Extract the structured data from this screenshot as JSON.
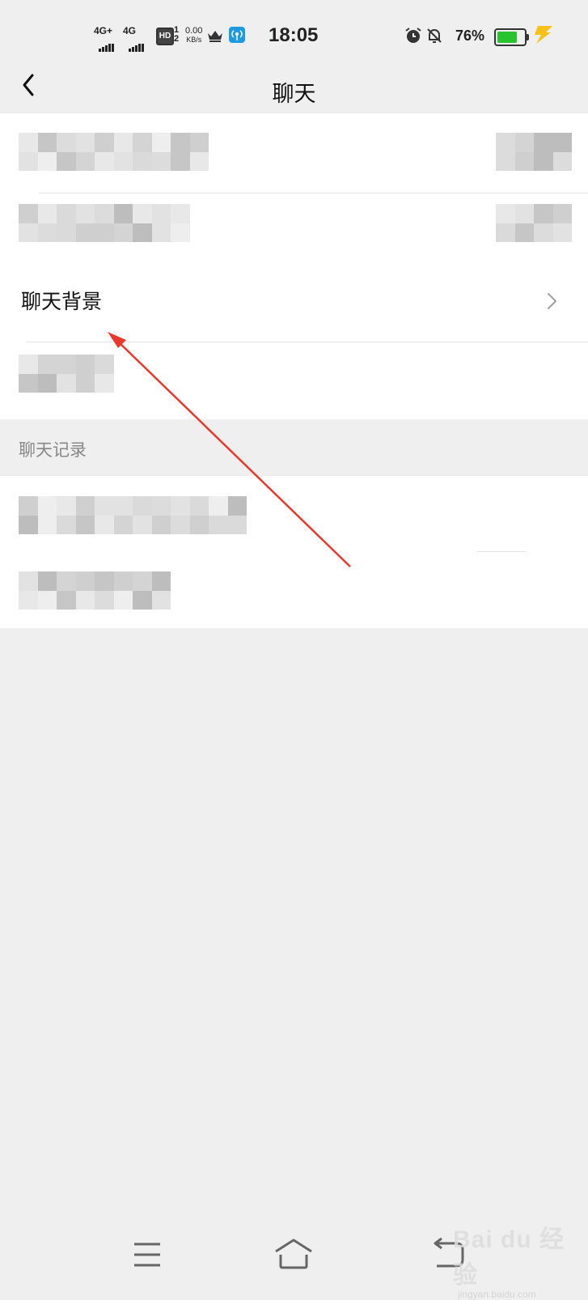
{
  "status_bar": {
    "net1": "4G+",
    "net2": "4G",
    "hd": "HD",
    "sim_index": "1 2",
    "speed_value": "0.00",
    "speed_unit": "KB/s",
    "time": "18:05",
    "battery_percent": "76%",
    "battery_level": 0.76,
    "battery_color": "#28c42d"
  },
  "header": {
    "title": "聊天",
    "back_icon": "chevron-left-icon"
  },
  "settings": {
    "chat_background_label": "聊天背景",
    "chevron_icon": "chevron-right-icon"
  },
  "section": {
    "chat_history_title": "聊天记录"
  },
  "navbar": {
    "menu_icon": "menu-icon",
    "home_icon": "home-icon",
    "back_icon": "back-icon"
  },
  "watermark": {
    "brand": "Bai du 经验",
    "url": "jingyan.baidu.com"
  },
  "annotation": {
    "arrow_color": "#e8392c"
  }
}
